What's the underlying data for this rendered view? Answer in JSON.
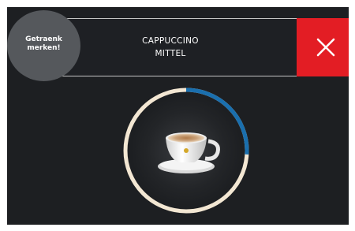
{
  "mark_button": {
    "label_line1": "Getraenk",
    "label_line2": "merken!"
  },
  "drink": {
    "name": "CAPPUCCINO",
    "strength": "MITTEL"
  },
  "close_button": {
    "icon": "close-icon"
  },
  "progress": {
    "fraction": 0.26
  },
  "colors": {
    "background": "#1d1f22",
    "close_red": "#e31d24",
    "mark_gray": "#55585c",
    "ring_track": "#f3e7d3",
    "ring_progress": "#1a6fae"
  }
}
